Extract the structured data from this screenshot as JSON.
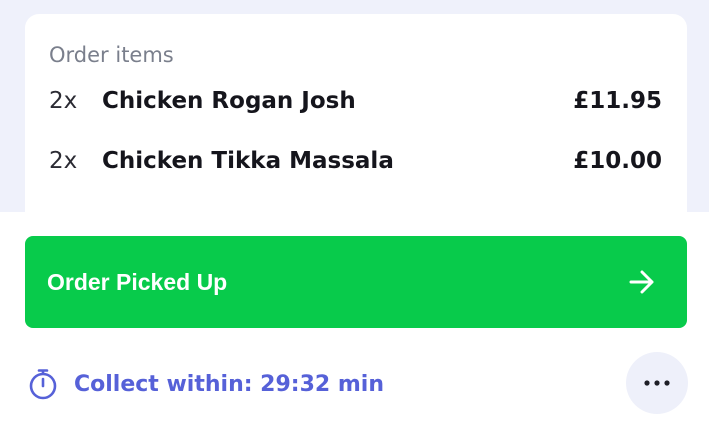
{
  "order_items": {
    "heading": "Order items",
    "items": [
      {
        "qty": "2x",
        "name": "Chicken Rogan Josh",
        "price": "£11.95"
      },
      {
        "qty": "2x",
        "name": "Chicken Tikka Massala",
        "price": "£10.00"
      }
    ]
  },
  "actions": {
    "pickup_label": "Order Picked Up",
    "pickup_icon": "arrow-right-icon",
    "more_icon": "more-horizontal-icon"
  },
  "collect": {
    "text": "Collect within: 29:32 min",
    "icon": "timer-icon"
  },
  "colors": {
    "accent_green": "#08cb4b",
    "accent_blue": "#5661d8",
    "background": "#eff1fb"
  }
}
